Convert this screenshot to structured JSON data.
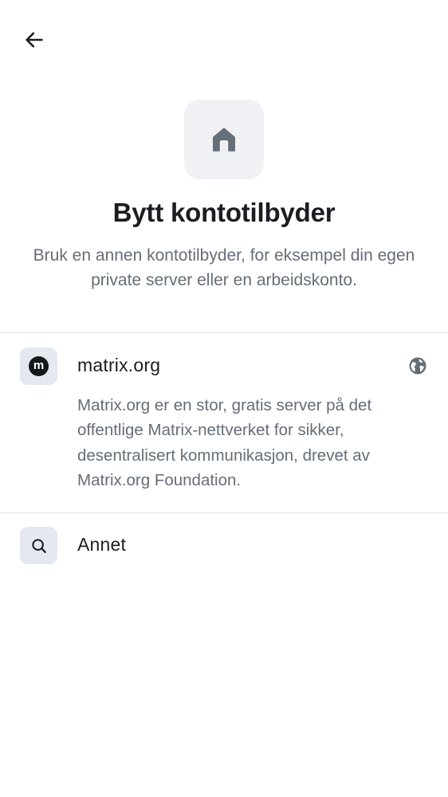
{
  "header": {
    "back_icon": "arrow-left-icon"
  },
  "hero": {
    "icon": "home-icon",
    "title": "Bytt kontotilbyder",
    "subtitle": "Bruk en annen kontotilbyder, for eksempel din egen private server eller en arbeidskonto."
  },
  "providers": [
    {
      "icon": "matrix-logo-icon",
      "icon_letter": "m",
      "name": "matrix.org",
      "trailing_icon": "globe-icon",
      "description": "Matrix.org er en stor, gratis server på det offentlige Matrix-nettverket for sikker, desentralisert kommunikasjon, drevet av Matrix.org Foundation."
    },
    {
      "icon": "search-icon",
      "name": "Annet"
    }
  ],
  "colors": {
    "text_primary": "#1b1d22",
    "text_secondary": "#656d77",
    "icon_bg": "#e4e8ef",
    "hero_bg": "#eff1f4",
    "divider": "#e1e4e8"
  }
}
